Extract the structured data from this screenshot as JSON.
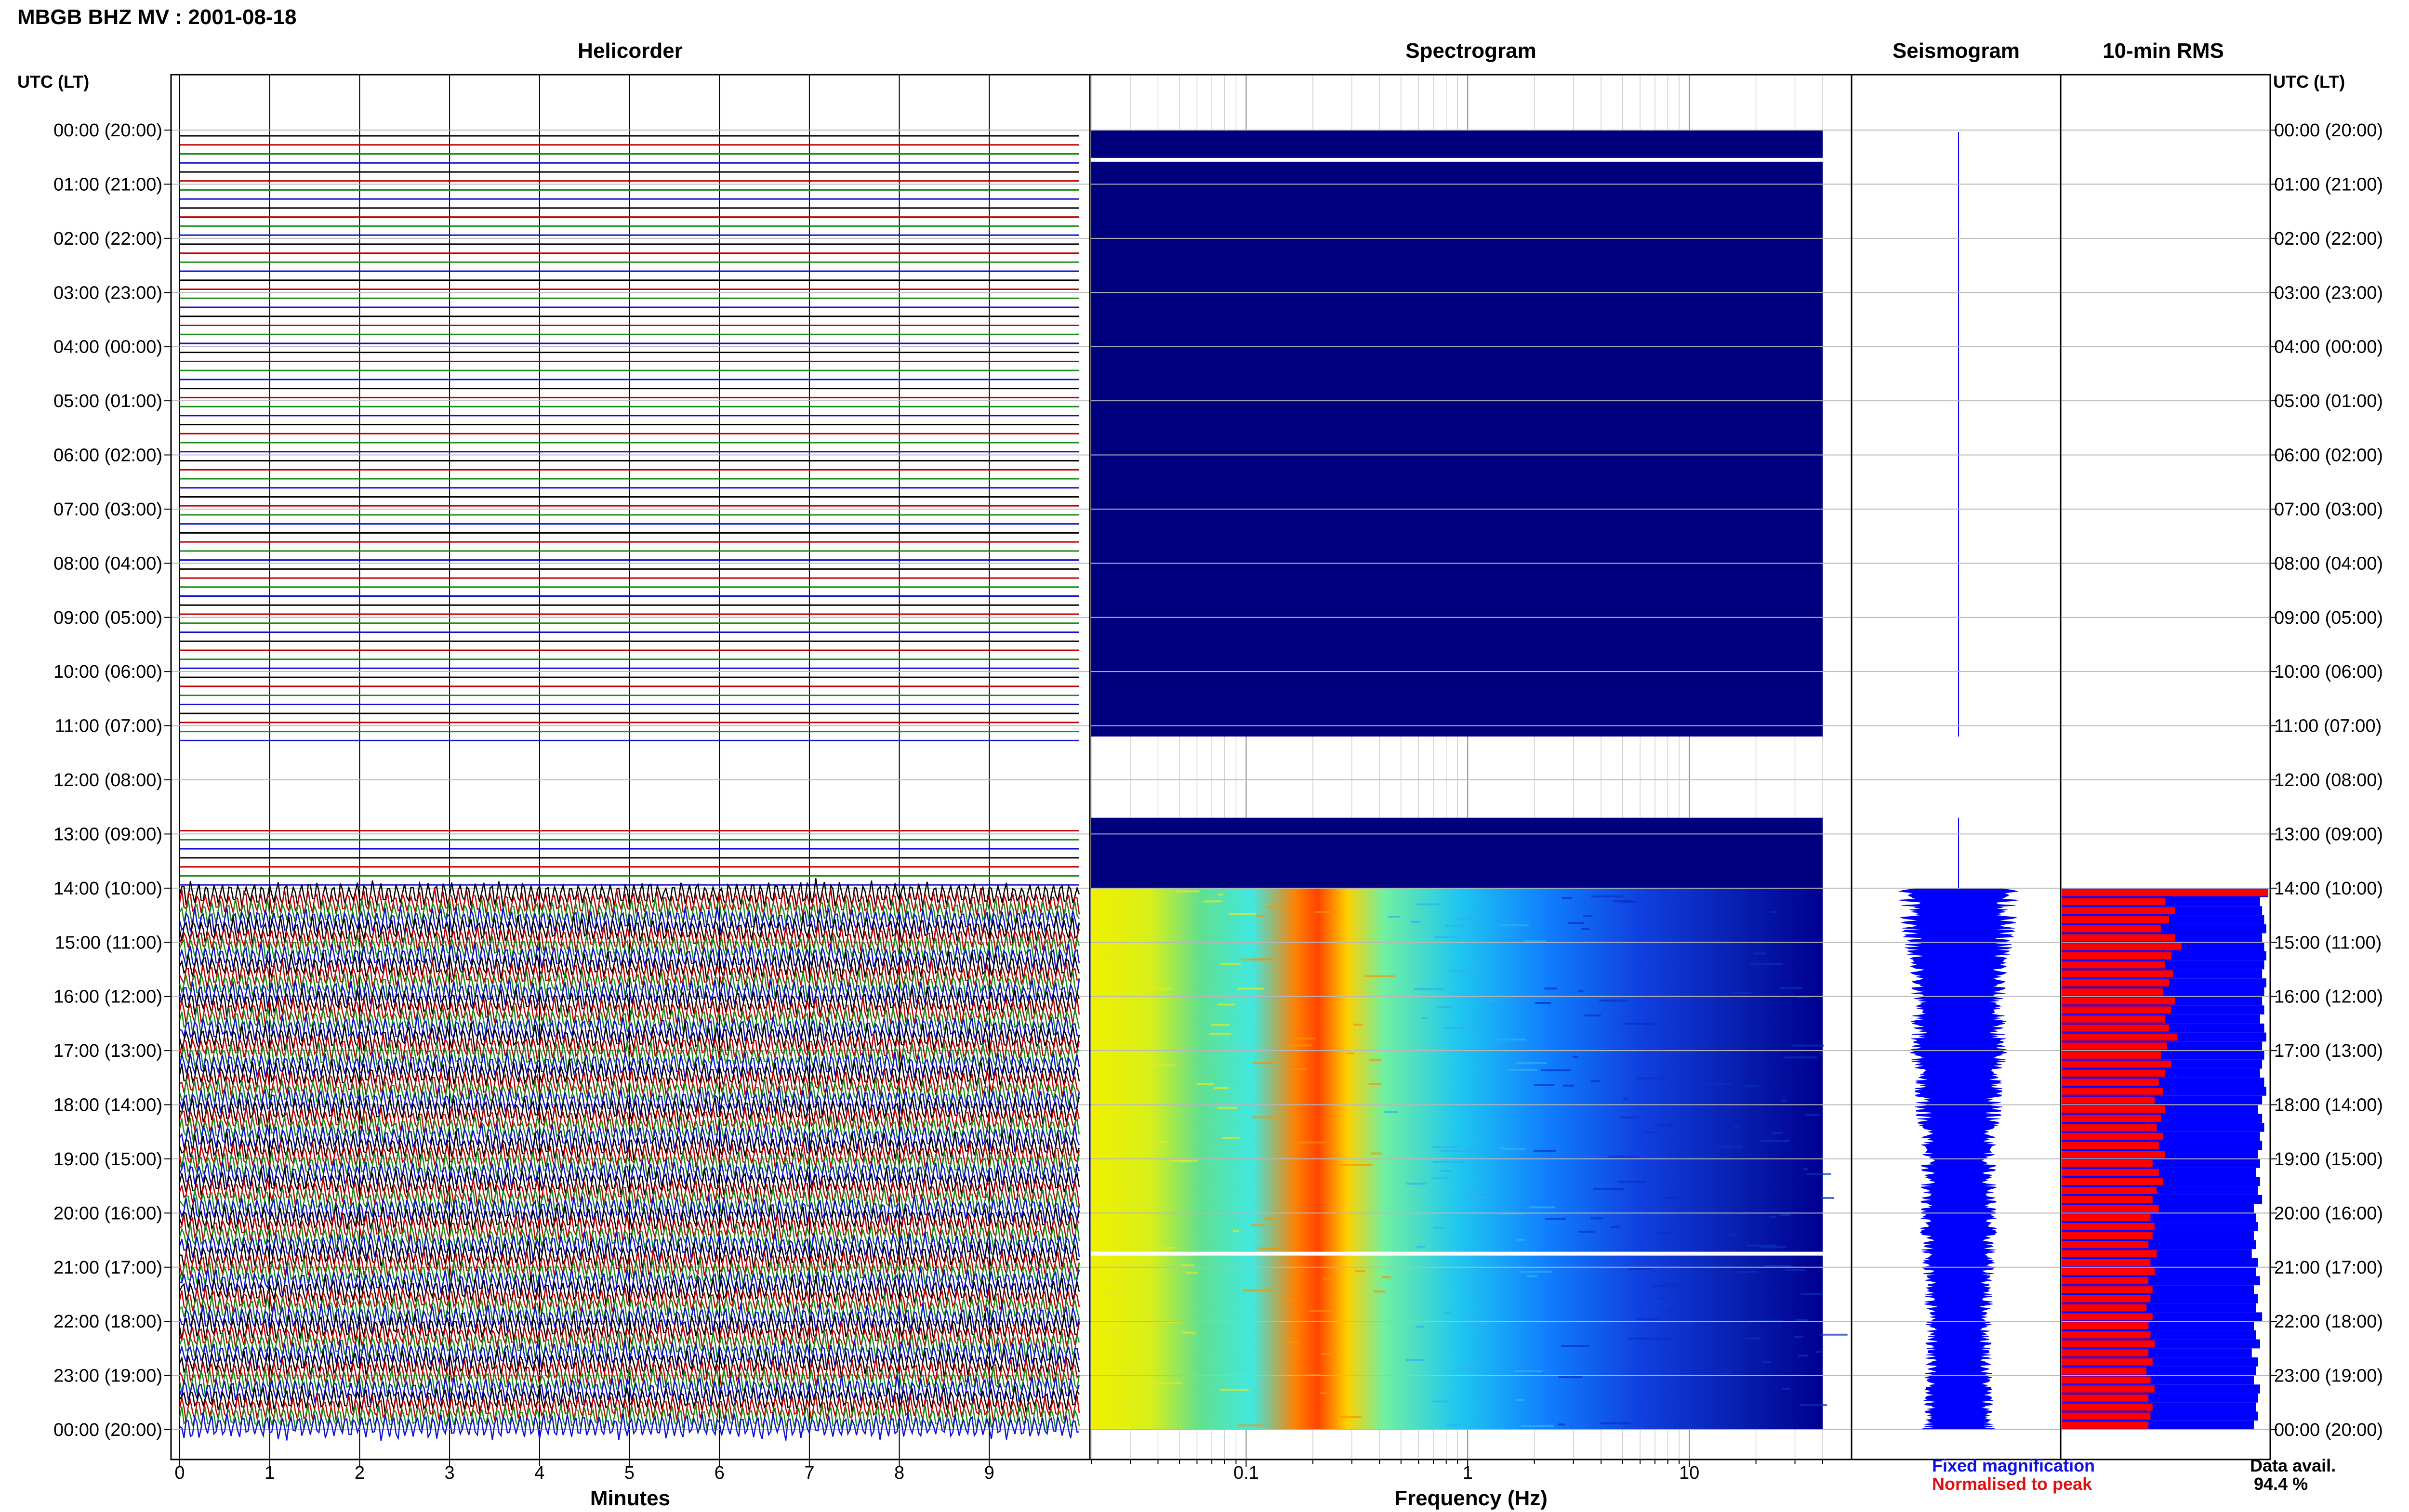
{
  "figure": {
    "title": "MBGB BHZ MV : 2001-08-18",
    "panels": [
      "Helicorder",
      "Spectrogram",
      "Seismogram",
      "10-min RMS"
    ],
    "utc_lt_header": "UTC (LT)",
    "x_label_helicorder": "Minutes",
    "x_label_spectrogram": "Frequency (Hz)",
    "legend_fixed": "Fixed magnification",
    "legend_normalised": "Normalised to peak",
    "data_avail_label": "Data avail.",
    "data_avail_value": "94.4 %",
    "colors": {
      "trace_cycle": [
        "#000000",
        "#c00000",
        "#1a8c1a",
        "#1010d0"
      ],
      "spectrogram_background": "#00007f",
      "rms_fixed": "#0000ff",
      "rms_normalised": "#ff0000",
      "seismogram": "#0000ff"
    }
  },
  "chart_data": [
    {
      "type": "line",
      "panel": "Helicorder",
      "xlabel": "Minutes",
      "xlim": [
        0,
        10
      ],
      "x_ticks": [
        0,
        1,
        2,
        3,
        4,
        5,
        6,
        7,
        8,
        9
      ],
      "ylabel": "UTC (LT)",
      "hour_labels": [
        "00:00 (20:00)",
        "01:00 (21:00)",
        "02:00 (22:00)",
        "03:00 (23:00)",
        "04:00 (00:00)",
        "05:00 (01:00)",
        "06:00 (02:00)",
        "07:00 (03:00)",
        "08:00 (04:00)",
        "09:00 (05:00)",
        "10:00 (06:00)",
        "11:00 (07:00)",
        "12:00 (08:00)",
        "13:00 (09:00)",
        "14:00 (10:00)",
        "15:00 (11:00)",
        "16:00 (12:00)",
        "17:00 (13:00)",
        "18:00 (14:00)",
        "19:00 (15:00)",
        "20:00 (16:00)",
        "21:00 (17:00)",
        "22:00 (18:00)",
        "23:00 (19:00)",
        "00:00 (20:00)"
      ],
      "traces_per_hour": 6,
      "segments": [
        {
          "from_hour": 0,
          "to_hour": 11.2,
          "state": "flat"
        },
        {
          "from_hour": 11.2,
          "to_hour": 12.7,
          "state": "gap"
        },
        {
          "from_hour": 12.7,
          "to_hour": 14,
          "state": "flat"
        },
        {
          "from_hour": 14,
          "to_hour": 24,
          "state": "active"
        }
      ]
    },
    {
      "type": "heatmap",
      "panel": "Spectrogram",
      "xlabel": "Frequency (Hz)",
      "x_scale": "log",
      "xlim": [
        0.02,
        40
      ],
      "x_ticks": [
        0.1,
        1,
        10
      ],
      "rows_hours": [
        0,
        24
      ],
      "no_data_hours": [
        [
          0,
          11.2
        ],
        [
          12.7,
          14
        ]
      ],
      "missing_rows_hours": [
        0.55,
        20.75
      ],
      "dominant_band_hz": [
        0.2,
        0.45
      ],
      "peak_frequency_hz": 0.3
    },
    {
      "type": "area",
      "panel": "Seismogram",
      "hours": [
        14,
        15,
        16,
        17,
        18,
        19,
        20,
        21,
        22,
        23,
        24
      ],
      "relative_amplitude": [
        0.5,
        0.45,
        0.38,
        0.4,
        0.36,
        0.3,
        0.32,
        0.3,
        0.27,
        0.28,
        0.3
      ],
      "flat_until_hour": 14
    },
    {
      "type": "bar",
      "panel": "10-min RMS",
      "start_hour": 14,
      "interval_minutes": 10,
      "series": [
        {
          "name": "Fixed magnification",
          "values": [
            1.0,
            0.96,
            0.97,
            0.98,
            0.99,
            0.97,
            0.98,
            0.99,
            0.98,
            0.97,
            0.99,
            0.98,
            0.97,
            0.98,
            0.96,
            0.98,
            0.99,
            0.97,
            0.98,
            0.97,
            0.96,
            0.98,
            0.99,
            0.97,
            0.95,
            0.97,
            0.98,
            0.96,
            0.97,
            0.95,
            0.96,
            0.94,
            0.96,
            0.95,
            0.97,
            0.93,
            0.94,
            0.95,
            0.93,
            0.94,
            0.92,
            0.95,
            0.94,
            0.96,
            0.93,
            0.95,
            0.94,
            0.97,
            0.93,
            0.94,
            0.96,
            0.92,
            0.95,
            0.94,
            0.93,
            0.96,
            0.95,
            0.94,
            0.95,
            0.93
          ]
        },
        {
          "name": "Normalised to peak",
          "values": [
            1.0,
            0.5,
            0.55,
            0.52,
            0.48,
            0.55,
            0.58,
            0.53,
            0.5,
            0.54,
            0.52,
            0.49,
            0.55,
            0.53,
            0.5,
            0.52,
            0.56,
            0.51,
            0.48,
            0.53,
            0.5,
            0.47,
            0.49,
            0.45,
            0.5,
            0.48,
            0.46,
            0.49,
            0.47,
            0.5,
            0.44,
            0.47,
            0.49,
            0.46,
            0.44,
            0.47,
            0.43,
            0.45,
            0.44,
            0.42,
            0.46,
            0.43,
            0.45,
            0.42,
            0.44,
            0.43,
            0.41,
            0.44,
            0.42,
            0.43,
            0.45,
            0.42,
            0.44,
            0.41,
            0.43,
            0.45,
            0.42,
            0.44,
            0.43,
            0.42
          ]
        }
      ]
    }
  ]
}
